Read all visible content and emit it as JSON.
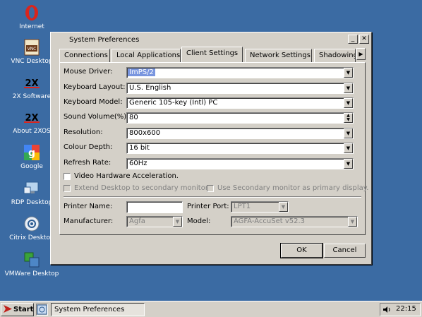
{
  "desktop": {
    "icons": [
      {
        "label": "Internet",
        "icon": "opera-icon"
      },
      {
        "label": "VNC Desktop",
        "icon": "vnc-icon"
      },
      {
        "label": "2X Software",
        "icon": "2x-icon"
      },
      {
        "label": "About 2XOS",
        "icon": "2x-icon"
      },
      {
        "label": "Google",
        "icon": "google-icon"
      },
      {
        "label": "RDP Desktop",
        "icon": "rdp-icon"
      },
      {
        "label": "Citrix Desktop",
        "icon": "citrix-icon"
      },
      {
        "label": "VMWare Desktop",
        "icon": "vmware-icon"
      }
    ],
    "background": "#3b6ba3"
  },
  "window": {
    "title": "System Preferences",
    "tabs": [
      "Connections",
      "Local Applications",
      "Client Settings",
      "Network Settings",
      "Shadowing"
    ],
    "active_tab": "Client Settings",
    "fields": {
      "mouse_driver": {
        "label": "Mouse Driver:",
        "value": "ImPS/2"
      },
      "keyboard_layout": {
        "label": "Keyboard Layout:",
        "value": "U.S. English"
      },
      "keyboard_model": {
        "label": "Keyboard Model:",
        "value": "Generic 105-key (Intl) PC"
      },
      "sound_volume": {
        "label": "Sound Volume(%):",
        "value": "80"
      },
      "resolution": {
        "label": "Resolution:",
        "value": "800x600"
      },
      "colour_depth": {
        "label": "Colour Depth:",
        "value": "16 bit"
      },
      "refresh_rate": {
        "label": "Refresh Rate:",
        "value": "60Hz"
      }
    },
    "checkboxes": {
      "video_accel": "Video Hardware Acceleration.",
      "extend_desktop": "Extend Desktop to secondary monitor.",
      "secondary_primary": "Use Secondary monitor as primary display."
    },
    "printer": {
      "name_label": "Printer Name:",
      "port_label": "Printer Port:",
      "port_value": "LPT1",
      "manufacturer_label": "Manufacturer:",
      "manufacturer_value": "Agfa",
      "model_label": "Model:",
      "model_value": "AGFA-AccuSet v52.3"
    },
    "ok_label": "OK",
    "cancel_label": "Cancel"
  },
  "taskbar": {
    "start_label": "Start",
    "task_label": "System Preferences",
    "time": "22:15"
  }
}
